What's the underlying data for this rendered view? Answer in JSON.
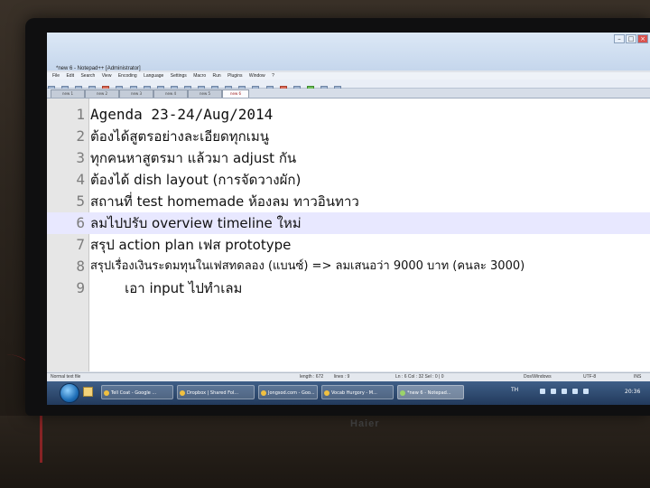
{
  "window": {
    "title": "*new 6 - Notepad++ [Administrator]",
    "controls": [
      "–",
      "□",
      "×"
    ]
  },
  "menu": [
    "File",
    "Edit",
    "Search",
    "View",
    "Encoding",
    "Language",
    "Settings",
    "Macro",
    "Run",
    "Plugins",
    "Window",
    "?"
  ],
  "tabs": [
    {
      "label": "new 1"
    },
    {
      "label": "new 2"
    },
    {
      "label": "new 3"
    },
    {
      "label": "new 4"
    },
    {
      "label": "new 5"
    },
    {
      "label": "new 6",
      "active": true
    }
  ],
  "editor": {
    "current_line": 6,
    "lines": [
      {
        "num": "1",
        "text": "Agenda 23-24/Aug/2014"
      },
      {
        "num": "2",
        "text": "ต้องได้สูตรอย่างละเอียดทุกเมนู"
      },
      {
        "num": "3",
        "text": "ทุกคนหาสูตรมา แล้วมา adjust กัน"
      },
      {
        "num": "4",
        "text": "ต้องได้ dish layout (การจัดวางผัก)"
      },
      {
        "num": "5",
        "text": "สถานที่ test homemade ห้องลม ทาวอินทาว"
      },
      {
        "num": "6",
        "text": "ลมไปปรับ overview timeline ใหม่"
      },
      {
        "num": "7",
        "text": "สรุป action plan เฟส prototype"
      },
      {
        "num": "8",
        "text": "สรุปเรื่องเงินระดมทุนในเฟสทดลอง (แบนซ์) => ลมเสนอว่า 9000 บาท (คนละ 3000)"
      },
      {
        "num": "9",
        "text": "        เอา input ไปทำเลม"
      }
    ]
  },
  "status": {
    "file_type": "Normal text file",
    "length": "length : 672",
    "lines": "lines : 9",
    "position": "Ln : 6    Col : 32    Sel : 0 | 0",
    "eol": "Dos\\Windows",
    "encoding": "UTF-8",
    "mode": "INS"
  },
  "taskbar": {
    "items": [
      {
        "label": "Tell Coat - Google ..."
      },
      {
        "label": "Dropbox | Shared Fol..."
      },
      {
        "label": "Jongsod.com - Goo..."
      },
      {
        "label": "Vocab Hurgory - M..."
      },
      {
        "label": "*new 6 - Notepad..."
      }
    ],
    "language": "TH",
    "clock": "20:36"
  },
  "monitor": {
    "brand": "Haier"
  }
}
